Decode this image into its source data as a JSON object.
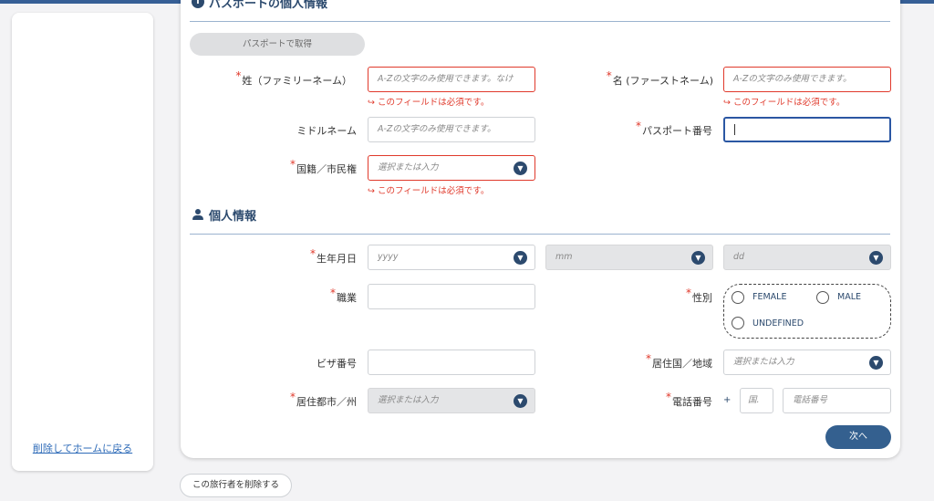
{
  "sidebar": {
    "back_link": "削除してホームに戻る"
  },
  "passport_section": {
    "title": "パスポートの個人情報",
    "fetch_button": "パスポートで取得",
    "last_name": {
      "label": "姓（ファミリーネーム）",
      "placeholder": "A-Zの文字のみ使用できます。なけ",
      "error": "↪ このフィールドは必須です。"
    },
    "first_name": {
      "label": "名 (ファーストネーム)",
      "placeholder": "A-Zの文字のみ使用できます。",
      "error": "↪ このフィールドは必須です。"
    },
    "middle_name": {
      "label": "ミドルネーム",
      "placeholder": "A-Zの文字のみ使用できます。"
    },
    "passport_number": {
      "label": "パスポート番号",
      "value": ""
    },
    "nationality": {
      "label": "国籍／市民権",
      "placeholder": "選択または入力",
      "error": "↪ このフィールドは必須です。"
    }
  },
  "personal_section": {
    "title": "個人情報",
    "birth_date": {
      "label": "生年月日",
      "year_placeholder": "yyyy",
      "month_placeholder": "mm",
      "day_placeholder": "dd"
    },
    "occupation": {
      "label": "職業",
      "value": ""
    },
    "gender": {
      "label": "性別",
      "options": [
        "FEMALE",
        "MALE",
        "UNDEFINED"
      ]
    },
    "visa_number": {
      "label": "ビザ番号",
      "value": ""
    },
    "residence_country": {
      "label": "居住国／地域",
      "placeholder": "選択または入力"
    },
    "residence_city": {
      "label": "居住都市／州",
      "placeholder": "選択または入力"
    },
    "phone": {
      "label": "電話番号",
      "plus": "+",
      "country_placeholder": "国.",
      "number_placeholder": "電話番号"
    }
  },
  "actions": {
    "next": "次へ",
    "delete_traveler": "この旅行者を削除する"
  },
  "icons": {
    "info": "info-icon",
    "person": "person-icon",
    "chevron": "chevron-down-icon",
    "reply": "reply-arrow-icon"
  },
  "colors": {
    "accent": "#2c4a6e",
    "error": "#e0392b",
    "focus": "#2b57a3",
    "button": "#34608f"
  }
}
